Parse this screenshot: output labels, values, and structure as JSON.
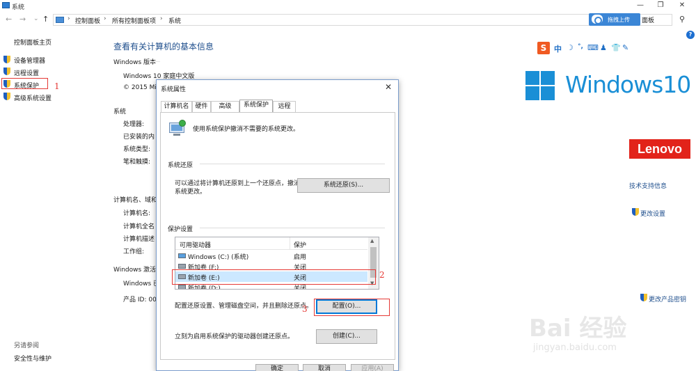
{
  "window": {
    "title": "系统",
    "minimize": "—",
    "maximize": "❐",
    "close": "✕"
  },
  "nav": {
    "back": "←",
    "forward": "→",
    "recent": "⌄",
    "up": "↑"
  },
  "breadcrumb": {
    "items": [
      "控制面板",
      "所有控制面板项",
      "系统"
    ],
    "separator": "›",
    "tail": "面板"
  },
  "upload_button": {
    "label": "拖拽上传"
  },
  "left_pane": {
    "home": "控制面板主页",
    "links": [
      "设备管理器",
      "远程设置",
      "系统保护",
      "高级系统设置"
    ],
    "see_also": "另请参阅",
    "see_also_links": [
      "安全性与维护"
    ]
  },
  "annotations": {
    "n1": "1",
    "n2": "2",
    "n3": "3"
  },
  "main": {
    "title": "查看有关计算机的基本信息",
    "windows_edition_label": "Windows 版本",
    "edition": "Windows 10 家庭中文版",
    "copyright": "© 2015 Mi",
    "system_label": "系统",
    "system_fields": [
      "处理器:",
      "已安装的内",
      "系统类型:",
      "笔和触摸:"
    ],
    "computer_label": "计算机名、域和",
    "computer_fields": [
      "计算机名:",
      "计算机全名",
      "计算机描述",
      "工作组:"
    ],
    "activation_label": "Windows 激活",
    "activation_fields": [
      "Windows 已",
      "产品 ID: 00"
    ],
    "support_link": "技术支持信息",
    "change_settings": "更改设置",
    "change_key": "更改产品密钥",
    "windows10_text": "Windows10",
    "lenovo_text": "Lenovo"
  },
  "sogou": {
    "logo": "S",
    "mode": "中"
  },
  "dialog": {
    "title": "系统属性",
    "close": "✕",
    "tabs": [
      "计算机名",
      "硬件",
      "高级",
      "系统保护",
      "远程"
    ],
    "active_tab": 3,
    "intro": "使用系统保护撤消不需要的系统更改。",
    "restore_group": "系统还原",
    "restore_desc_1": "可以通过将计算机还原到上一个还原点，撤消",
    "restore_desc_2": "系统更改。",
    "restore_button": "系统还原(S)...",
    "protect_group": "保护设置",
    "list": {
      "col_drive": "可用驱动器",
      "col_protect": "保护",
      "rows": [
        {
          "drive": "Windows (C:) (系统)",
          "protect": "启用"
        },
        {
          "drive": "新加卷 (F:)",
          "protect": "关闭"
        },
        {
          "drive": "新加卷 (E:)",
          "protect": "关闭"
        },
        {
          "drive": "新加卷 (D:)",
          "protect": "关闭"
        }
      ]
    },
    "configure_desc": "配置还原设置、管理磁盘空间，并且删除还原点。",
    "configure_button": "配置(O)...",
    "create_desc": "立刻为启用系统保护的驱动器创建还原点。",
    "create_button": "创建(C)...",
    "ok": "确定",
    "cancel": "取消",
    "apply": "应用(A)"
  },
  "watermark": {
    "big": "Bai 经验",
    "small": "jingyan.baidu.com"
  }
}
